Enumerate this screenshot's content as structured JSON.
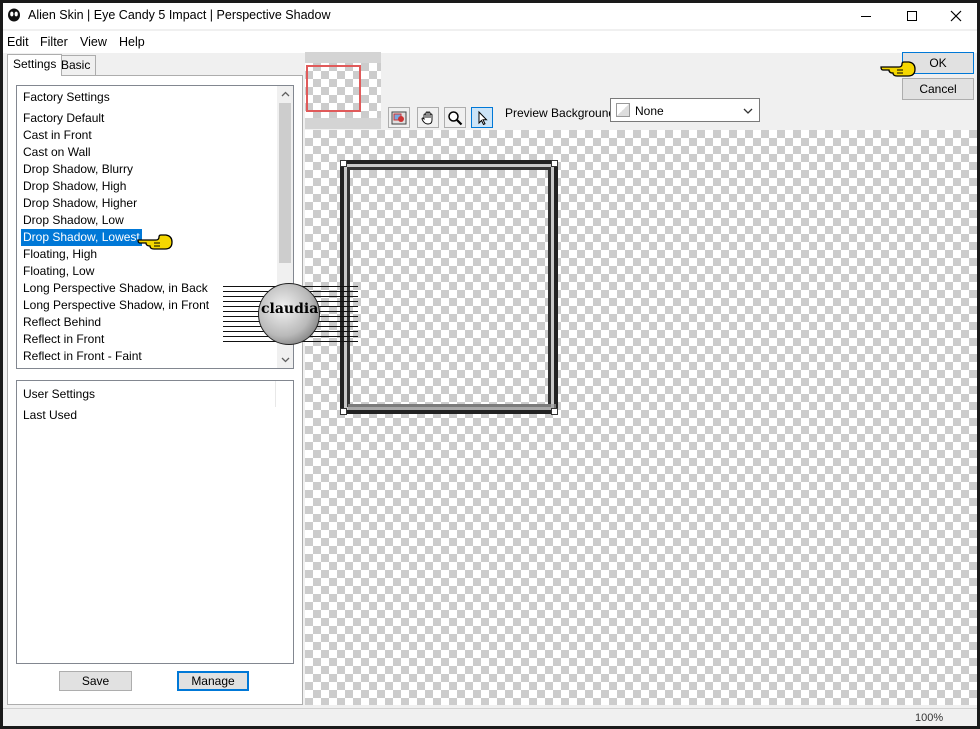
{
  "window": {
    "title": "Alien Skin | Eye Candy 5 Impact | Perspective Shadow"
  },
  "menu": [
    "Edit",
    "Filter",
    "View",
    "Help"
  ],
  "tabs": [
    {
      "label": "Settings"
    },
    {
      "label": "Basic"
    }
  ],
  "factory_settings": {
    "items": [
      "Factory Settings",
      "Factory Default",
      "Cast in Front",
      "Cast on Wall",
      "Drop Shadow, Blurry",
      "Drop Shadow, High",
      "Drop Shadow, Higher",
      "Drop Shadow, Low",
      "Drop Shadow, Lowest",
      "Floating, High",
      "Floating, Low",
      "Long Perspective Shadow, in Back",
      "Long Perspective Shadow, in Front",
      "Reflect Behind",
      "Reflect in Front",
      "Reflect in Front - Faint"
    ],
    "selected": "Drop Shadow, Lowest"
  },
  "user_settings": {
    "items": [
      "User Settings",
      "Last Used"
    ]
  },
  "buttons": {
    "save": "Save",
    "manage": "Manage",
    "ok": "OK",
    "cancel": "Cancel"
  },
  "preview": {
    "background_label": "Preview Background:",
    "background_value": "None",
    "zoom": "100%"
  },
  "watermark": {
    "text": "claudia"
  },
  "icons": {
    "app": "alien-skin-icon",
    "tools": [
      "navigate-icon",
      "hand-icon",
      "zoom-icon",
      "pointer-icon"
    ]
  },
  "colors": {
    "selection": "#0078d7",
    "pointer_hand": "#f5d700"
  }
}
